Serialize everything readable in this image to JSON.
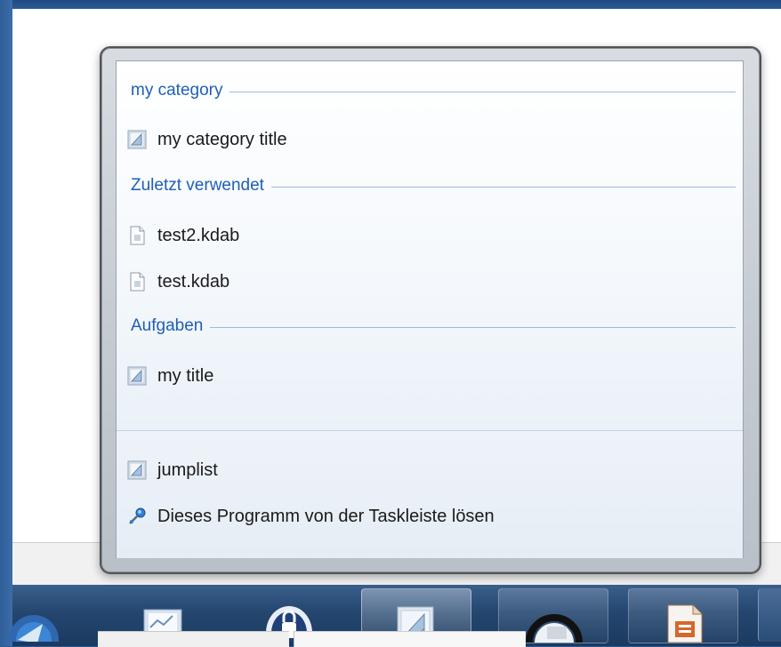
{
  "jumplist": {
    "categories": [
      {
        "title": "my category",
        "items": [
          {
            "label": "my category title",
            "icon": "app-icon"
          }
        ]
      },
      {
        "title": "Zuletzt verwendet",
        "items": [
          {
            "label": "test2.kdab",
            "icon": "document-icon"
          },
          {
            "label": "test.kdab",
            "icon": "document-icon"
          }
        ]
      },
      {
        "title": "Aufgaben",
        "items": [
          {
            "label": "my title",
            "icon": "app-icon"
          }
        ]
      }
    ],
    "footer": {
      "app": {
        "label": "jumplist",
        "icon": "app-icon"
      },
      "unpin": {
        "label": "Dieses Programm von der Taskleiste lösen",
        "icon": "unpin-icon"
      }
    }
  },
  "taskbar": {
    "buttons": [
      {
        "icon": "thunderbird-icon"
      },
      {
        "icon": "monitor-icon"
      },
      {
        "icon": "lock-icon"
      },
      {
        "icon": "app-icon",
        "state": "active"
      },
      {
        "icon": "headset-icon",
        "state": "pinned"
      },
      {
        "icon": "impress-icon",
        "state": "pinned"
      }
    ]
  },
  "colors": {
    "category_heading": "#1f5fb5",
    "taskbar": "#24466f"
  }
}
